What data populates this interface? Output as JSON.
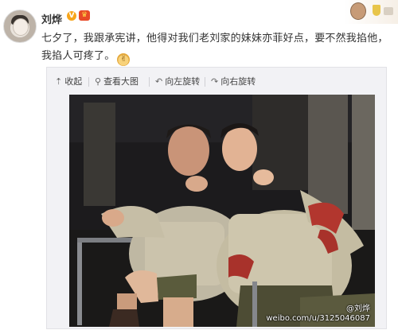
{
  "post": {
    "username": "刘烨",
    "verified_badge": "V",
    "vip_badge": "♛",
    "text": "七夕了，我跟承宪讲，他得对我们老刘家的妹妹亦菲好点，要不然我掐他，我掐人可疼了。",
    "emoji": "ok-hand-emoji"
  },
  "toolbar": {
    "collapse": "收起",
    "view_large": "查看大图",
    "rotate_left": "向左旋转",
    "rotate_right": "向右旋转"
  },
  "photo": {
    "watermark_name": "@刘烨",
    "watermark_url": "weibo.com/u/3125046087"
  },
  "icons": {
    "collapse": "arrow-up-icon",
    "view_large": "magnifier-icon",
    "rotate_left": "rotate-left-icon",
    "rotate_right": "rotate-right-icon"
  },
  "colors": {
    "verified": "#f7a51b",
    "vip": "#e84a27",
    "text": "#333333"
  }
}
